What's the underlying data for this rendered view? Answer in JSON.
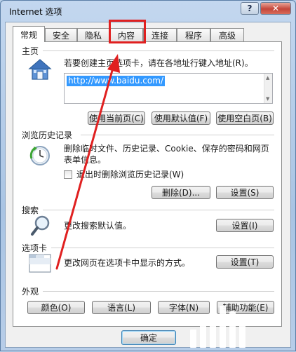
{
  "window": {
    "title": "Internet 选项",
    "help_label": "?",
    "close_label": "✕"
  },
  "tabs": [
    {
      "label": "常规",
      "active": true
    },
    {
      "label": "安全"
    },
    {
      "label": "隐私"
    },
    {
      "label": "内容"
    },
    {
      "label": "连接"
    },
    {
      "label": "程序"
    },
    {
      "label": "高级"
    }
  ],
  "homepage": {
    "label": "主页",
    "instruction": "若要创建主页选项卡，请在各地址行键入地址(R)。",
    "url": "http://www.baidu.com/",
    "buttons": [
      "使用当前页(C)",
      "使用默认值(F)",
      "使用空白页(B)"
    ]
  },
  "history": {
    "label": "浏览历史记录",
    "description_line1": "删除临时文件、历史记录、Cookie、保存的密码和网页",
    "description_line2": "表单信息。",
    "checkbox_label": "退出时删除浏览历史记录(W)",
    "delete_button": "删除(D)...",
    "settings_button": "设置(S)"
  },
  "search": {
    "label": "搜索",
    "description": "更改搜索默认值。",
    "settings_button": "设置(I)"
  },
  "tabbed": {
    "label": "选项卡",
    "description": "更改网页在选项卡中显示的方式。",
    "settings_button": "设置(T)"
  },
  "appearance": {
    "label": "外观",
    "buttons": [
      "颜色(O)",
      "语言(L)",
      "字体(N)",
      "辅助功能(E)"
    ]
  },
  "footer": {
    "ok_button": "确定"
  },
  "annotation": {
    "highlight_color": "#e02020"
  }
}
